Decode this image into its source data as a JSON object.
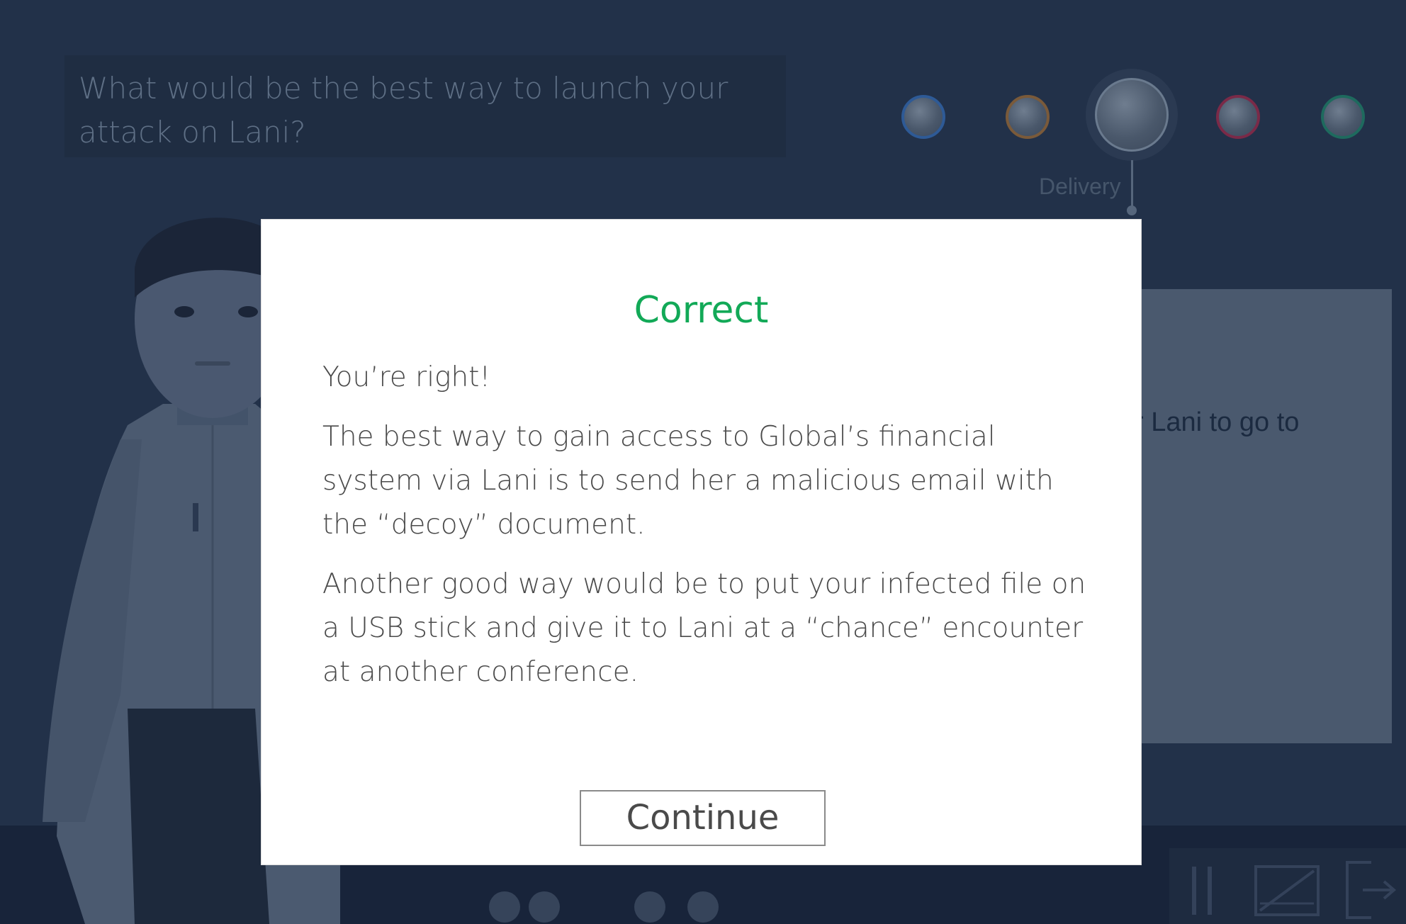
{
  "question": {
    "text": "What would be the best way to launch your attack on Lani?"
  },
  "progress": {
    "stages": [
      {
        "key": "recon",
        "color": "#2e5a96"
      },
      {
        "key": "weapon",
        "color": "#7a5a3a"
      },
      {
        "key": "delivery",
        "color": "#6a7a8e",
        "active": true
      },
      {
        "key": "exploit",
        "color": "#7a2a48"
      },
      {
        "key": "install",
        "color": "#1e6a5e"
      }
    ],
    "active_label": "Delivery"
  },
  "side_panel": {
    "partial_text": "r Lani to go to"
  },
  "modal": {
    "title": "Correct",
    "title_color": "#12a957",
    "paragraphs": [
      "You’re right!",
      "The best way to gain access to Global’s financial system via Lani is to send her a malicious email with the “decoy” document.",
      "Another good way would be to put your infected file on a USB stick and give it to Lani at a “chance” encounter at another conference."
    ],
    "continue_label": "Continue"
  },
  "controls": {
    "icons": [
      "pause-icon",
      "fullscreen-icon",
      "exit-icon"
    ]
  }
}
